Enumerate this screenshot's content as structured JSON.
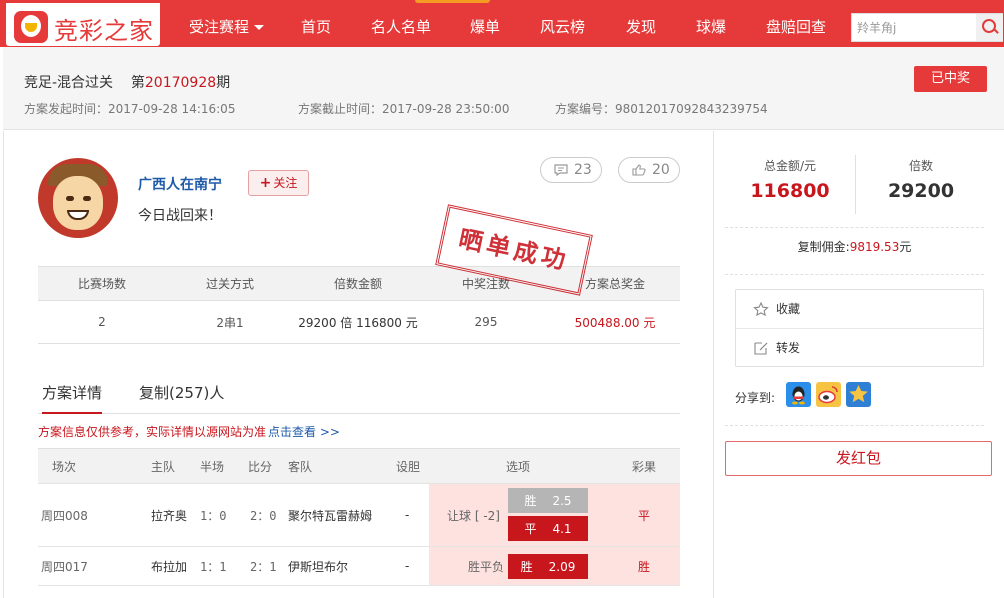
{
  "header": {
    "logo_text": "竞彩之家",
    "nav": [
      {
        "label": "受注赛程",
        "dropdown": true
      },
      {
        "label": "首页"
      },
      {
        "label": "名人名单"
      },
      {
        "label": "爆单"
      },
      {
        "label": "风云榜"
      },
      {
        "label": "发现"
      },
      {
        "label": "球爆"
      },
      {
        "label": "盘赔回查"
      }
    ],
    "search": {
      "value": "羚羊角j"
    }
  },
  "plan": {
    "title_prefix": "竞足-混合过关",
    "issue_label_pre": "第",
    "issue_no": "20170928",
    "issue_label_post": "期",
    "start_time": "方案发起时间：2017-09-28 14:16:05",
    "end_time": "方案截止时间：2017-09-28 23:50:00",
    "plan_no": "方案编号：980120170928432397​54",
    "status_badge": "已中奖"
  },
  "user": {
    "name": "广西人在南宁",
    "follow_label": "关注",
    "follow_icon": "+",
    "tagline": "今日战回来！",
    "comments": "23",
    "likes": "20",
    "stamp": "晒单成功"
  },
  "summary": {
    "headers": [
      "比赛场数",
      "过关方式",
      "倍数金额",
      "中奖注数",
      "方案总奖金"
    ],
    "values": [
      "2",
      "2串1",
      "29200 倍  116800 元",
      "295",
      "500488.00 元"
    ]
  },
  "tabs": {
    "detail": "方案详情",
    "copy": "复制(257)人"
  },
  "notice": {
    "text": "方案信息仅供参考，实际详情以源网站为准",
    "link": "点击查看 >>"
  },
  "matches": {
    "headers": [
      "场次",
      "主队",
      "半场",
      "比分",
      "客队",
      "设胆",
      "选项",
      "彩果"
    ],
    "rows": [
      {
        "id": "周四008",
        "home": "拉齐奥",
        "half": "1：0",
        "score": "2：0",
        "away": "聚尔特瓦雷赫姆",
        "banker": "-",
        "play": "让球 [ -2]",
        "options": [
          {
            "k": "胜",
            "v": "2.5",
            "style": "gray"
          },
          {
            "k": "平",
            "v": "4.1",
            "style": "red"
          }
        ],
        "result": "平"
      },
      {
        "id": "周四017",
        "home": "布拉加",
        "half": "1：1",
        "score": "2：1",
        "away": "伊斯坦布尔",
        "banker": "-",
        "play": "胜平负",
        "options": [
          {
            "k": "胜",
            "v": "2.09",
            "style": "red"
          }
        ],
        "result": "胜"
      }
    ]
  },
  "sidebar": {
    "total_label": "总金额/元",
    "total_value": "116800",
    "multiple_label": "倍数",
    "multiple_value": "29200",
    "commission_label": "复制佣金:",
    "commission_value": "9819.53",
    "commission_unit": "元",
    "favorite": "收藏",
    "forward": "转发",
    "share_label": "分享到:",
    "share_icons": [
      "qq-icon",
      "weibo-icon",
      "qzone-icon"
    ],
    "red_packet": "发红包"
  },
  "colors": {
    "brand": "#e63a3a",
    "accent_text": "#c8161d",
    "link": "#1e5aa8",
    "option_bg": "#fde2e0"
  }
}
